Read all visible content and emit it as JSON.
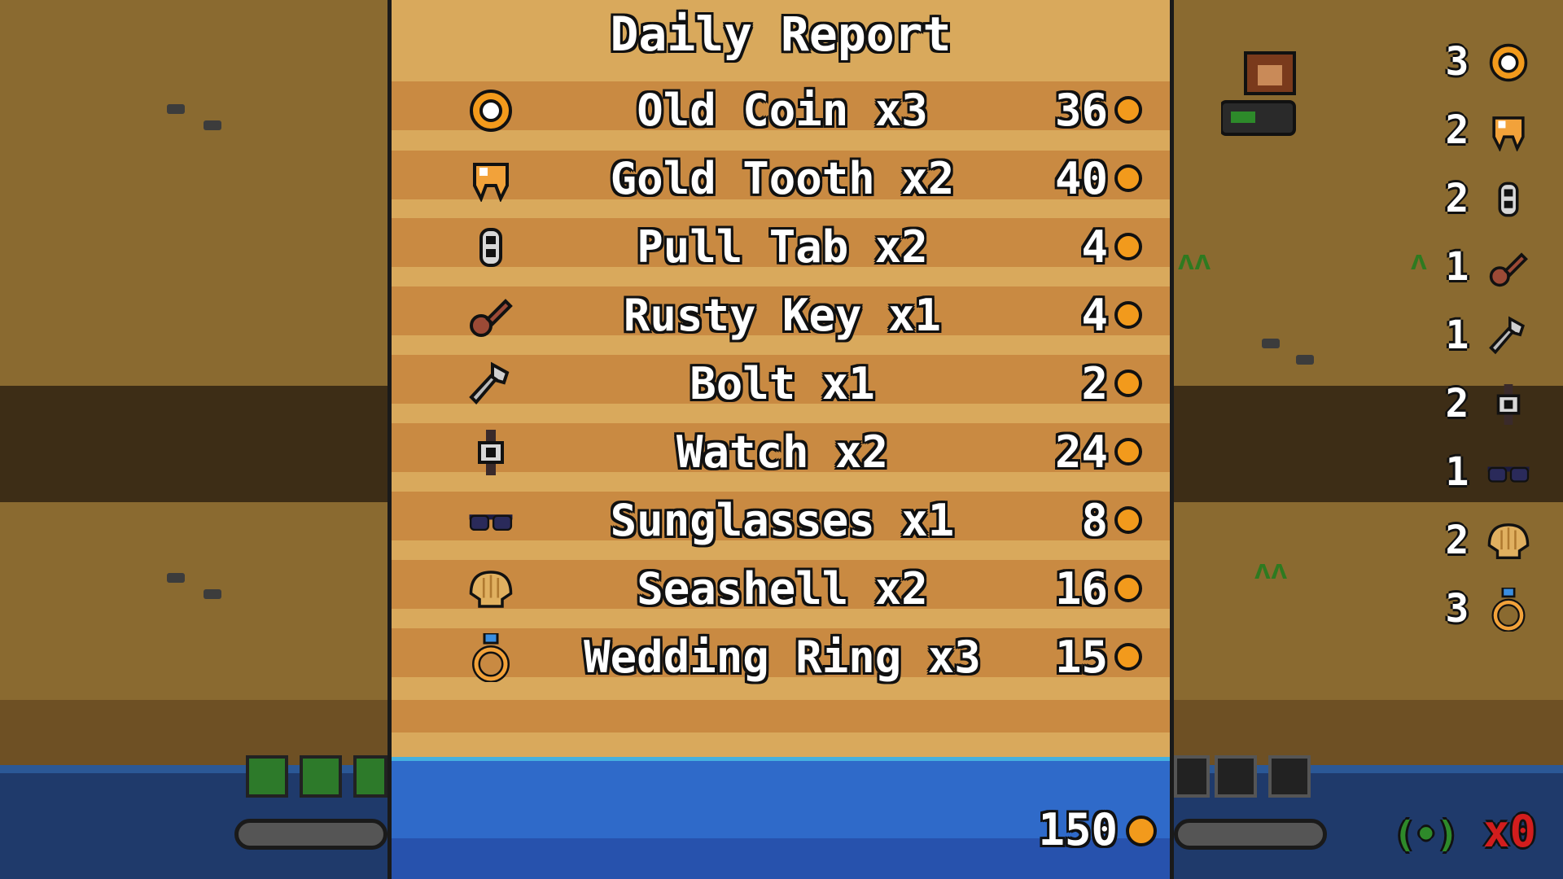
{
  "report": {
    "title": "Daily Report",
    "items": [
      {
        "label": "Old Coin x3",
        "value": "36",
        "icon": "old-coin-icon"
      },
      {
        "label": "Gold Tooth x2",
        "value": "40",
        "icon": "gold-tooth-icon"
      },
      {
        "label": "Pull Tab x2",
        "value": "4",
        "icon": "pull-tab-icon"
      },
      {
        "label": "Rusty Key x1",
        "value": "4",
        "icon": "rusty-key-icon"
      },
      {
        "label": "Bolt x1",
        "value": "2",
        "icon": "bolt-icon"
      },
      {
        "label": "Watch x2",
        "value": "24",
        "icon": "watch-icon"
      },
      {
        "label": "Sunglasses x1",
        "value": "8",
        "icon": "sunglasses-icon"
      },
      {
        "label": "Seashell x2",
        "value": "16",
        "icon": "seashell-icon"
      },
      {
        "label": "Wedding Ring x3",
        "value": "15",
        "icon": "wedding-ring-icon"
      }
    ],
    "total": "150"
  },
  "inventory": [
    {
      "count": "3",
      "icon": "old-coin-icon"
    },
    {
      "count": "2",
      "icon": "gold-tooth-icon"
    },
    {
      "count": "2",
      "icon": "pull-tab-icon"
    },
    {
      "count": "1",
      "icon": "rusty-key-icon"
    },
    {
      "count": "1",
      "icon": "bolt-icon"
    },
    {
      "count": "2",
      "icon": "watch-icon"
    },
    {
      "count": "1",
      "icon": "sunglasses-icon"
    },
    {
      "count": "2",
      "icon": "seashell-icon"
    },
    {
      "count": "3",
      "icon": "wedding-ring-icon"
    }
  ],
  "hud": {
    "multiplier": "x0",
    "gamepad_glyph": "(•)"
  },
  "colors": {
    "coin": "#f29a1c",
    "sand": "#d9a95c",
    "sand_stripe": "#c98a42",
    "water": "#2f6ac9",
    "multiplier": "#d21d1d"
  }
}
